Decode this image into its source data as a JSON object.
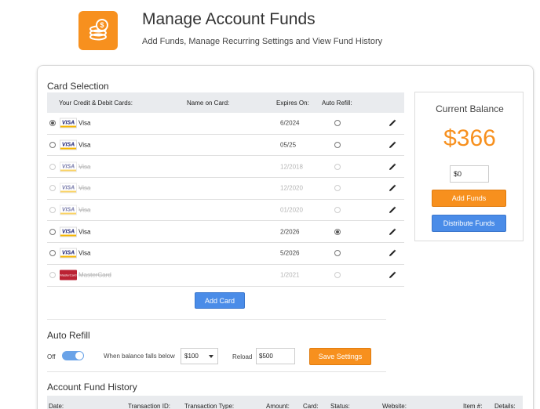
{
  "header": {
    "title": "Manage Account Funds",
    "subtitle": "Add Funds, Manage Recurring Settings and View Fund History",
    "icon": "coins-icon"
  },
  "card_selection": {
    "title": "Card Selection",
    "columns": [
      "Your Credit & Debit Cards:",
      "Name on Card:",
      "Expires On:",
      "Auto Refill:"
    ],
    "cards": [
      {
        "brand": "visa",
        "name": "Visa",
        "expires": "6/2024",
        "selected": true,
        "auto_refill": false,
        "disabled": false
      },
      {
        "brand": "visa",
        "name": "Visa",
        "expires": "05/25",
        "selected": false,
        "auto_refill": false,
        "disabled": false
      },
      {
        "brand": "visa",
        "name": "Visa",
        "expires": "12/2018",
        "selected": false,
        "auto_refill": false,
        "disabled": true
      },
      {
        "brand": "visa",
        "name": "Visa",
        "expires": "12/2020",
        "selected": false,
        "auto_refill": false,
        "disabled": true
      },
      {
        "brand": "visa",
        "name": "Visa",
        "expires": "01/2020",
        "selected": false,
        "auto_refill": false,
        "disabled": true
      },
      {
        "brand": "visa",
        "name": "Visa",
        "expires": "2/2026",
        "selected": false,
        "auto_refill": true,
        "disabled": false
      },
      {
        "brand": "visa",
        "name": "Visa",
        "expires": "5/2026",
        "selected": false,
        "auto_refill": false,
        "disabled": false
      },
      {
        "brand": "mastercard",
        "name": "MasterCard",
        "expires": "1/2021",
        "selected": false,
        "auto_refill": false,
        "disabled": true
      }
    ],
    "brand_logo_text": {
      "visa": "VISA",
      "mastercard": "MasterCard"
    },
    "add_card_label": "Add Card"
  },
  "balance": {
    "label": "Current Balance",
    "amount": "$366",
    "input_value": "$0",
    "add_funds_label": "Add Funds",
    "distribute_label": "Distribute Funds"
  },
  "auto_refill": {
    "title": "Auto Refill",
    "toggle_label": "Off",
    "toggle_on": true,
    "threshold_label": "When balance falls below",
    "threshold_value": "$100",
    "reload_label": "Reload",
    "reload_value": "$500",
    "save_label": "Save Settings"
  },
  "history": {
    "title": "Account Fund History",
    "columns": [
      "Date:",
      "Transaction ID:",
      "Transaction Type:",
      "Amount:",
      "Card:",
      "Status:",
      "Website:",
      "Item #:",
      "Details:"
    ]
  },
  "colors": {
    "accent_orange": "#f7901e",
    "accent_blue": "#4a8ce8",
    "header_gray": "#e9ebee"
  }
}
